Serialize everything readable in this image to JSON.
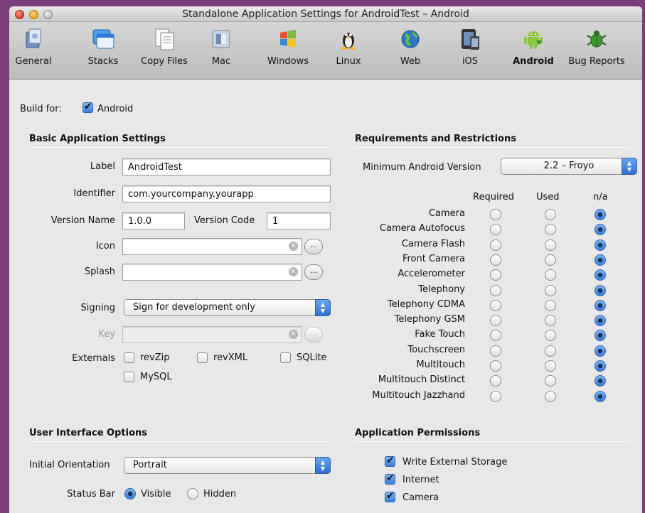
{
  "window": {
    "title": "Standalone Application Settings for AndroidTest – Android"
  },
  "toolbar": {
    "items": [
      {
        "label": "General",
        "icon": "general-icon",
        "active": false
      },
      {
        "label": "Stacks",
        "icon": "stacks-icon",
        "active": false
      },
      {
        "label": "Copy Files",
        "icon": "copy-files-icon",
        "active": false
      },
      {
        "label": "Mac",
        "icon": "mac-icon",
        "active": false
      },
      {
        "label": "Windows",
        "icon": "windows-icon",
        "active": false
      },
      {
        "label": "Linux",
        "icon": "linux-icon",
        "active": false
      },
      {
        "label": "Web",
        "icon": "web-icon",
        "active": false
      },
      {
        "label": "iOS",
        "icon": "ios-icon",
        "active": false
      },
      {
        "label": "Android",
        "icon": "android-icon",
        "active": true
      },
      {
        "label": "Bug Reports",
        "icon": "bug-icon",
        "active": false
      }
    ]
  },
  "build": {
    "label": "Build for:",
    "checkbox_label": "Android",
    "checked": true
  },
  "basic": {
    "heading": "Basic Application Settings",
    "label_label": "Label",
    "label_value": "AndroidTest",
    "identifier_label": "Identifier",
    "identifier_value": "com.yourcompany.yourapp",
    "version_name_label": "Version Name",
    "version_name_value": "1.0.0",
    "version_code_label": "Version Code",
    "version_code_value": "1",
    "icon_label": "Icon",
    "icon_value": "",
    "splash_label": "Splash",
    "splash_value": "",
    "browse_label": "...",
    "signing_label": "Signing",
    "signing_value": "Sign for development only",
    "key_label": "Key",
    "key_value": "",
    "externals_label": "Externals",
    "externals": [
      {
        "label": "revZip",
        "checked": false
      },
      {
        "label": "revXML",
        "checked": false
      },
      {
        "label": "SQLite",
        "checked": false
      },
      {
        "label": "MySQL",
        "checked": false
      }
    ]
  },
  "requirements": {
    "heading": "Requirements and Restrictions",
    "min_version_label": "Minimum Android Version",
    "min_version_value": "2.2 – Froyo",
    "columns": [
      "Required",
      "Used",
      "n/a"
    ],
    "rows": [
      {
        "label": "Camera",
        "value": "n/a"
      },
      {
        "label": "Camera Autofocus",
        "value": "n/a"
      },
      {
        "label": "Camera Flash",
        "value": "n/a"
      },
      {
        "label": "Front Camera",
        "value": "n/a"
      },
      {
        "label": "Accelerometer",
        "value": "n/a"
      },
      {
        "label": "Telephony",
        "value": "n/a"
      },
      {
        "label": "Telephony CDMA",
        "value": "n/a"
      },
      {
        "label": "Telephony GSM",
        "value": "n/a"
      },
      {
        "label": "Fake Touch",
        "value": "n/a"
      },
      {
        "label": "Touchscreen",
        "value": "n/a"
      },
      {
        "label": "Multitouch",
        "value": "n/a"
      },
      {
        "label": "Multitouch Distinct",
        "value": "n/a"
      },
      {
        "label": "Multitouch Jazzhand",
        "value": "n/a"
      }
    ]
  },
  "ui_options": {
    "heading": "User Interface Options",
    "orientation_label": "Initial Orientation",
    "orientation_value": "Portrait",
    "status_bar_label": "Status Bar",
    "status_visible_label": "Visible",
    "status_hidden_label": "Hidden",
    "status_value": "Visible"
  },
  "permissions": {
    "heading": "Application Permissions",
    "items": [
      {
        "label": "Write External Storage",
        "checked": true
      },
      {
        "label": "Internet",
        "checked": true
      },
      {
        "label": "Camera",
        "checked": true
      }
    ]
  }
}
